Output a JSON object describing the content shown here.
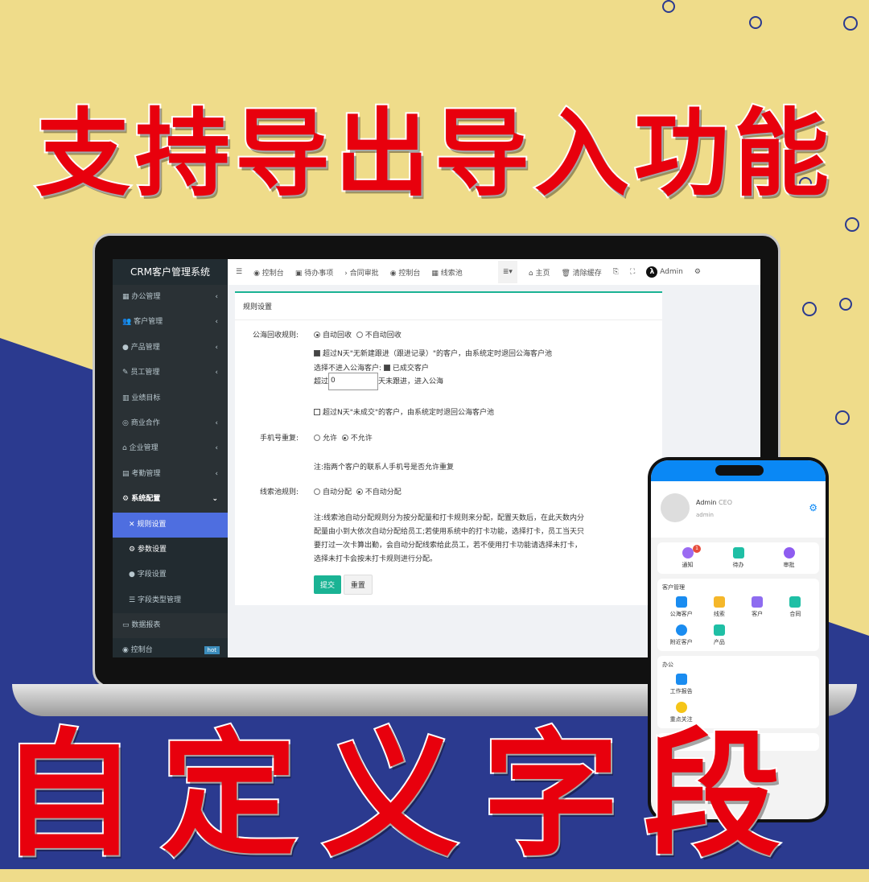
{
  "headline_top": "支持导出导入功能",
  "headline_bottom": "自定义字段",
  "colors": {
    "background_yellow": "#efdc8a",
    "background_navy": "#2b3a8f",
    "headline": "#e8000d",
    "accent_teal": "#1ab394",
    "sidebar_active": "#4e6ee0",
    "phone_header": "#0a88f5"
  },
  "app": {
    "brand": "CRM客户管理系统"
  },
  "sidebar": {
    "items": [
      {
        "label": "办公管理",
        "icon": "windows-icon"
      },
      {
        "label": "客户管理",
        "icon": "users-icon"
      },
      {
        "label": "产品管理",
        "icon": "product-icon"
      },
      {
        "label": "员工管理",
        "icon": "brush-icon"
      },
      {
        "label": "业绩目标",
        "icon": "bar-chart-icon"
      },
      {
        "label": "商业合作",
        "icon": "handshake-icon"
      },
      {
        "label": "企业管理",
        "icon": "bank-icon"
      },
      {
        "label": "考勤管理",
        "icon": "calendar-icon"
      },
      {
        "label": "系统配置",
        "icon": "gear-icon"
      },
      {
        "label": "规则设置",
        "icon": "arrows-icon"
      },
      {
        "label": "参数设置",
        "icon": "cogs-icon"
      },
      {
        "label": "字段设置",
        "icon": "dot-icon"
      },
      {
        "label": "字段类型管理",
        "icon": "list-icon"
      },
      {
        "label": "数据报表",
        "icon": "laptop-icon"
      },
      {
        "label": "控制台",
        "icon": "dashboard-icon",
        "badge": "hot"
      }
    ]
  },
  "topbar": {
    "tabs": [
      "控制台",
      "待办事项",
      "合同审批",
      "控制台",
      "线索池"
    ],
    "home": "主页",
    "clear_cache": "清除缓存",
    "user": "Admin"
  },
  "form": {
    "title": "规则设置",
    "pool_rule_label": "公海回收规则:",
    "pool_options": [
      "自动回收",
      "不自动回收"
    ],
    "pool_check1": "超过N天\"无新建跟进（跟进记录）\"的客户，由系统定时退回公海客户池",
    "exclude_label": "选择不进入公海客户:",
    "exclude_option": "已成交客户",
    "days_prefix": "超过",
    "days_value": "0",
    "days_suffix": "天未跟进，进入公海",
    "pool_check2": "超过N天\"未成交\"的客户，由系统定时退回公海客户池",
    "phone_label": "手机号重复:",
    "phone_options": [
      "允许",
      "不允许"
    ],
    "phone_note": "注:指两个客户的联系人手机号是否允许重复",
    "lead_label": "线索池规则:",
    "lead_options": [
      "自动分配",
      "不自动分配"
    ],
    "lead_note": "注:线索池自动分配规则分为按分配量和打卡规则来分配，配置天数后，在此天数内分配量由小到大依次自动分配给员工;若使用系统中的打卡功能，选择打卡，员工当天只要打过一次卡算出勤，会自动分配线索给此员工，若不使用打卡功能请选择未打卡，选择未打卡会按未打卡规则进行分配。",
    "submit": "提交",
    "reset": "重置"
  },
  "phone": {
    "name": "Admin",
    "role": "CEO",
    "username": "admin",
    "quick": [
      {
        "label": "通知",
        "badge": "1"
      },
      {
        "label": "待办"
      },
      {
        "label": "审批"
      }
    ],
    "sections": [
      {
        "title": "客户管理",
        "items": [
          "公海客户",
          "线索",
          "客户",
          "合同",
          "附近客户",
          "产品"
        ]
      },
      {
        "title": "办公",
        "items": [
          "工作报告",
          "重点关注"
        ]
      },
      {
        "title": "财务",
        "items": []
      }
    ]
  }
}
